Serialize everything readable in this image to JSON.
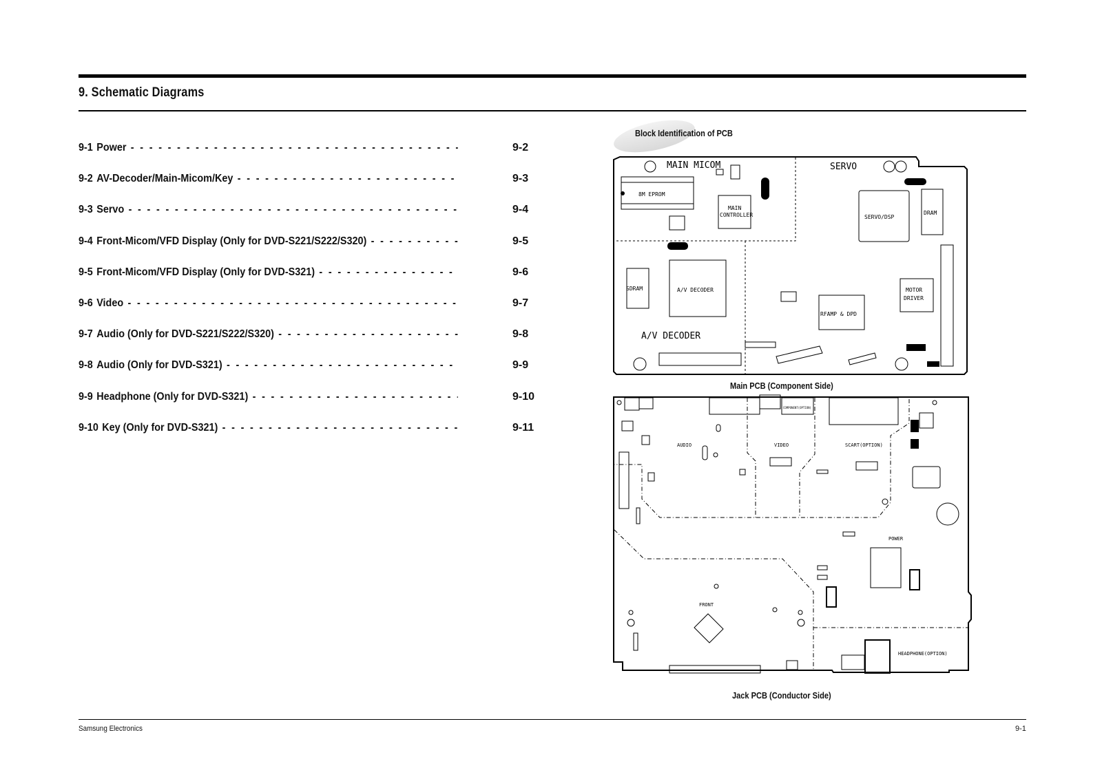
{
  "header": {
    "title": "9. Schematic Diagrams"
  },
  "toc": [
    {
      "num": "9-1",
      "label": "Power",
      "page": "9-2"
    },
    {
      "num": "9-2",
      "label": "AV-Decoder/Main-Micom/Key",
      "page": "9-3"
    },
    {
      "num": "9-3",
      "label": "Servo",
      "page": "9-4"
    },
    {
      "num": "9-4",
      "label": "Front-Micom/VFD Display (Only for DVD-S221/S222/S320)",
      "page": "9-5"
    },
    {
      "num": "9-5",
      "label": "Front-Micom/VFD Display (Only for DVD-S321)",
      "page": "9-6"
    },
    {
      "num": "9-6",
      "label": "Video",
      "page": "9-7"
    },
    {
      "num": "9-7",
      "label": "Audio (Only for DVD-S221/S222/S320)",
      "page": "9-8"
    },
    {
      "num": "9-8",
      "label": "Audio (Only for DVD-S321)",
      "page": "9-9"
    },
    {
      "num": "9-9",
      "label": "Headphone (Only for DVD-S321)",
      "page": "9-10"
    },
    {
      "num": "9-10",
      "label": "Key (Only for DVD-S321)",
      "page": "9-11"
    }
  ],
  "pcb": {
    "section_title": "Block Identification of PCB",
    "main_caption": "Main PCB (Component Side)",
    "jack_caption": "Jack PCB (Conductor Side)",
    "main_blocks": {
      "main_micom": "MAIN MICOM",
      "servo": "SERVO",
      "eprom": "8M EPROM",
      "main_controller_1": "MAIN",
      "main_controller_2": "CONTROLLER",
      "servo_dsp": "SERVO/DSP",
      "dram": "DRAM",
      "sdram": "SDRAM",
      "av_decoder_chip": "A/V DECODER",
      "av_decoder_area": "A/V DECODER",
      "rfamp": "RFAMP & DPD",
      "motor_1": "MOTOR",
      "motor_2": "DRIVER"
    },
    "jack_blocks": {
      "audio": "AUDIO",
      "video": "VIDEO",
      "scart": "SCART(OPTION)",
      "power": "POWER",
      "front": "FRONT",
      "headphone": "HEADPHONE(OPTION)",
      "component": "COMPONENT(OPTION)"
    }
  },
  "footer": {
    "company": "Samsung Electronics",
    "page": "9-1"
  }
}
